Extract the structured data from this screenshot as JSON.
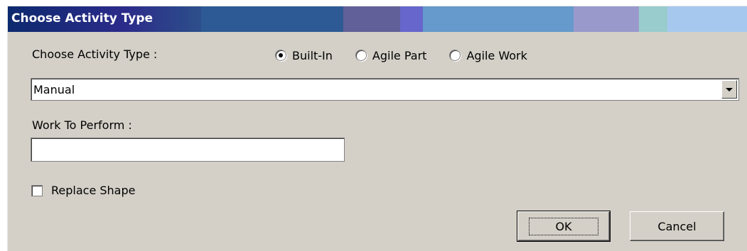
{
  "dialog": {
    "title": "Choose Activity Type",
    "title_colors": [
      "#2b2b8a",
      "#2d5a94",
      "#626098",
      "#6666cc",
      "#6699cc",
      "#9999cc",
      "#99cccc",
      "#a6c8ee"
    ]
  },
  "activity_type": {
    "label": "Choose Activity Type :",
    "options": [
      {
        "label": "Built-In",
        "checked": true
      },
      {
        "label": "Agile Part",
        "checked": false
      },
      {
        "label": "Agile Work",
        "checked": false
      }
    ]
  },
  "activity_select": {
    "value": "Manual"
  },
  "work_to_perform": {
    "label": "Work To Perform :",
    "value": ""
  },
  "replace_shape": {
    "label": "Replace Shape",
    "checked": false
  },
  "buttons": {
    "ok": "OK",
    "cancel": "Cancel"
  }
}
